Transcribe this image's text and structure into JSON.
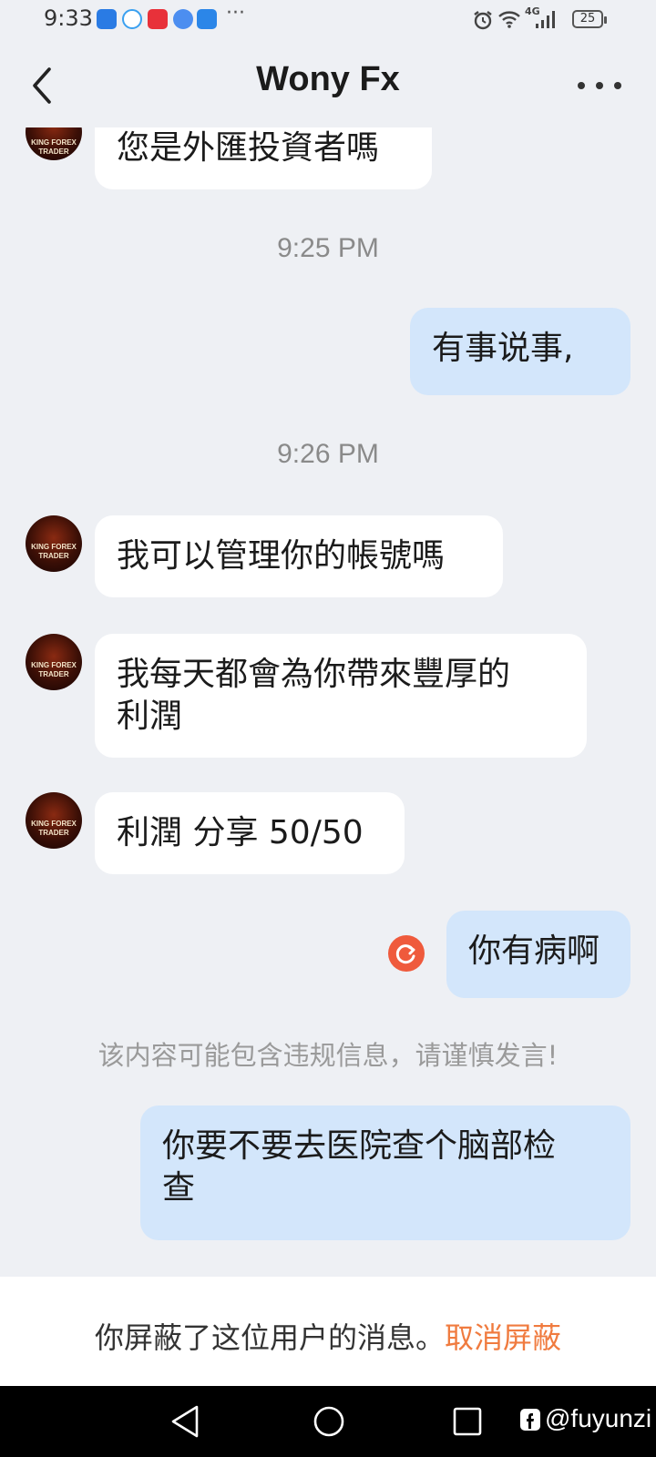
{
  "status": {
    "time": "9:33",
    "network": "4G",
    "battery": "25",
    "more_dots": "···"
  },
  "header": {
    "title": "Wony Fx"
  },
  "avatar": {
    "line1": "KING FOREX",
    "line2": "TRADER"
  },
  "messages": {
    "m1": "您是外匯投資者嗎",
    "t1": "9:25 PM",
    "m2": "有事说事,",
    "t2": "9:26 PM",
    "m3": "我可以管理你的帳號嗎",
    "m4a": "我每天都會為你帶來豐厚的",
    "m4b": "利潤",
    "m5": "利潤 分享  50/50",
    "m6": "你有病啊",
    "warning": "该内容可能包含违规信息，请谨慎发言!",
    "m7a": "你要不要去医院查个脑部检",
    "m7b": "查"
  },
  "blockbar": {
    "text": "你屏蔽了这位用户的消息。",
    "action": "取消屏蔽"
  },
  "credit": "@fuyunzi",
  "colors": {
    "background": "#eef0f4",
    "mine_bubble": "#d3e6fb",
    "accent_orange": "#f07b3f",
    "resend_red": "#ef5a3c"
  }
}
